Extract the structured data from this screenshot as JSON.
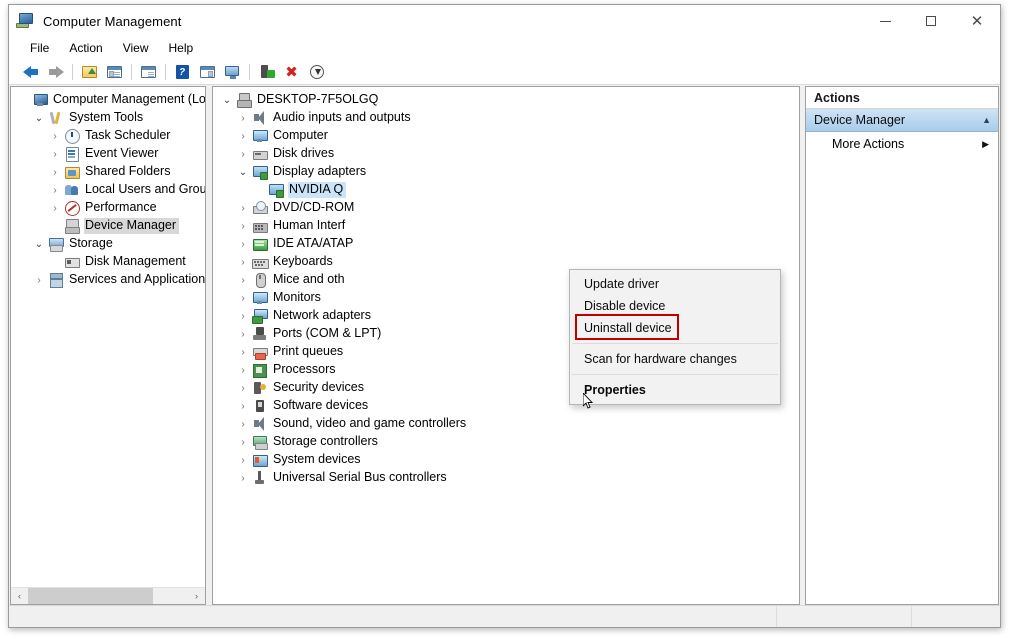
{
  "window": {
    "title": "Computer Management",
    "icon": "computer-management-icon",
    "controls": {
      "minimize": "—",
      "maximize": "□",
      "close": "✕"
    }
  },
  "menubar": {
    "items": [
      "File",
      "Action",
      "View",
      "Help"
    ]
  },
  "toolbar": {
    "buttons": [
      {
        "name": "back-icon",
        "kind": "back"
      },
      {
        "name": "forward-icon",
        "kind": "forward"
      },
      {
        "name": "separator",
        "kind": "sep"
      },
      {
        "name": "up-one-level-icon",
        "kind": "folder"
      },
      {
        "name": "show-hide-console-tree-icon",
        "kind": "win-left"
      },
      {
        "name": "separator",
        "kind": "sep"
      },
      {
        "name": "properties-icon",
        "kind": "win-doc"
      },
      {
        "name": "separator",
        "kind": "sep"
      },
      {
        "name": "help-icon",
        "kind": "help"
      },
      {
        "name": "show-hide-action-pane-icon",
        "kind": "win-right"
      },
      {
        "name": "display-icon",
        "kind": "monitor"
      },
      {
        "name": "separator",
        "kind": "sep"
      },
      {
        "name": "update-driver-icon",
        "kind": "plug"
      },
      {
        "name": "uninstall-device-icon",
        "kind": "redx"
      },
      {
        "name": "scan-hardware-changes-icon",
        "kind": "download"
      }
    ]
  },
  "console_tree": {
    "items": [
      {
        "label": "Computer Management (Local",
        "indent": 0,
        "twisty": "none",
        "icon": "ic-computer",
        "selected": false
      },
      {
        "label": "System Tools",
        "indent": 1,
        "twisty": "expanded",
        "icon": "ic-tools",
        "selected": false
      },
      {
        "label": "Task Scheduler",
        "indent": 2,
        "twisty": "collapsed",
        "icon": "ic-clock",
        "selected": false
      },
      {
        "label": "Event Viewer",
        "indent": 2,
        "twisty": "collapsed",
        "icon": "ic-event",
        "selected": false
      },
      {
        "label": "Shared Folders",
        "indent": 2,
        "twisty": "collapsed",
        "icon": "ic-shared",
        "selected": false
      },
      {
        "label": "Local Users and Groups",
        "indent": 2,
        "twisty": "collapsed",
        "icon": "ic-users",
        "selected": false
      },
      {
        "label": "Performance",
        "indent": 2,
        "twisty": "collapsed",
        "icon": "ic-perf",
        "selected": false
      },
      {
        "label": "Device Manager",
        "indent": 2,
        "twisty": "none",
        "icon": "ic-devmgr",
        "selected": true
      },
      {
        "label": "Storage",
        "indent": 1,
        "twisty": "expanded",
        "icon": "ic-storage",
        "selected": false
      },
      {
        "label": "Disk Management",
        "indent": 2,
        "twisty": "none",
        "icon": "ic-disk",
        "selected": false
      },
      {
        "label": "Services and Applications",
        "indent": 1,
        "twisty": "collapsed",
        "icon": "ic-services",
        "selected": false
      }
    ],
    "hscroll": {
      "left_arrow": "‹",
      "right_arrow": "›"
    }
  },
  "device_tree": {
    "items": [
      {
        "label": "DESKTOP-7F5OLGQ",
        "indent": 0,
        "twisty": "expanded",
        "icon": "ic-root",
        "selected": false
      },
      {
        "label": "Audio inputs and outputs",
        "indent": 1,
        "twisty": "collapsed",
        "icon": "ic-audio",
        "selected": false
      },
      {
        "label": "Computer",
        "indent": 1,
        "twisty": "collapsed",
        "icon": "ic-monitor",
        "selected": false
      },
      {
        "label": "Disk drives",
        "indent": 1,
        "twisty": "collapsed",
        "icon": "ic-drive",
        "selected": false
      },
      {
        "label": "Display adapters",
        "indent": 1,
        "twisty": "expanded",
        "icon": "ic-display",
        "selected": false
      },
      {
        "label": "NVIDIA Q",
        "indent": 2,
        "twisty": "none",
        "icon": "ic-display",
        "selected": true
      },
      {
        "label": "DVD/CD-ROM",
        "indent": 1,
        "twisty": "collapsed",
        "icon": "ic-cd",
        "selected": false
      },
      {
        "label": "Human Interf",
        "indent": 1,
        "twisty": "collapsed",
        "icon": "ic-hid",
        "selected": false
      },
      {
        "label": "IDE ATA/ATAP",
        "indent": 1,
        "twisty": "collapsed",
        "icon": "ic-ide",
        "selected": false
      },
      {
        "label": "Keyboards",
        "indent": 1,
        "twisty": "collapsed",
        "icon": "ic-kbd",
        "selected": false
      },
      {
        "label": "Mice and oth",
        "indent": 1,
        "twisty": "collapsed",
        "icon": "ic-mouse",
        "selected": false
      },
      {
        "label": "Monitors",
        "indent": 1,
        "twisty": "collapsed",
        "icon": "ic-monitor",
        "selected": false
      },
      {
        "label": "Network adapters",
        "indent": 1,
        "twisty": "collapsed",
        "icon": "ic-net",
        "selected": false
      },
      {
        "label": "Ports (COM & LPT)",
        "indent": 1,
        "twisty": "collapsed",
        "icon": "ic-port",
        "selected": false
      },
      {
        "label": "Print queues",
        "indent": 1,
        "twisty": "collapsed",
        "icon": "ic-print",
        "selected": false
      },
      {
        "label": "Processors",
        "indent": 1,
        "twisty": "collapsed",
        "icon": "ic-cpu",
        "selected": false
      },
      {
        "label": "Security devices",
        "indent": 1,
        "twisty": "collapsed",
        "icon": "ic-sec",
        "selected": false
      },
      {
        "label": "Software devices",
        "indent": 1,
        "twisty": "collapsed",
        "icon": "ic-soft",
        "selected": false
      },
      {
        "label": "Sound, video and game controllers",
        "indent": 1,
        "twisty": "collapsed",
        "icon": "ic-sound",
        "selected": false
      },
      {
        "label": "Storage controllers",
        "indent": 1,
        "twisty": "collapsed",
        "icon": "ic-stor2",
        "selected": false
      },
      {
        "label": "System devices",
        "indent": 1,
        "twisty": "collapsed",
        "icon": "ic-sysdev",
        "selected": false
      },
      {
        "label": "Universal Serial Bus controllers",
        "indent": 1,
        "twisty": "collapsed",
        "icon": "ic-usb",
        "selected": false
      }
    ]
  },
  "actions_pane": {
    "header": "Actions",
    "group_title": "Device Manager",
    "group_chevron": "▲",
    "items": [
      {
        "label": "More Actions",
        "submenu_arrow": "▶"
      }
    ]
  },
  "context_menu": {
    "highlight_color": "#c00000",
    "highlighted_item": "Uninstall device",
    "items": [
      {
        "label": "Update driver",
        "type": "item",
        "bold": false
      },
      {
        "label": "Disable device",
        "type": "item",
        "bold": false
      },
      {
        "label": "Uninstall device",
        "type": "item",
        "bold": false,
        "highlighted": true
      },
      {
        "label": "",
        "type": "separator"
      },
      {
        "label": "Scan for hardware changes",
        "type": "item",
        "bold": false
      },
      {
        "label": "",
        "type": "separator"
      },
      {
        "label": "Properties",
        "type": "item",
        "bold": true
      }
    ]
  },
  "statusbar": {
    "cells": [
      "",
      "",
      ""
    ]
  },
  "twisty_glyphs": {
    "expanded": "⌄",
    "collapsed": "›"
  }
}
